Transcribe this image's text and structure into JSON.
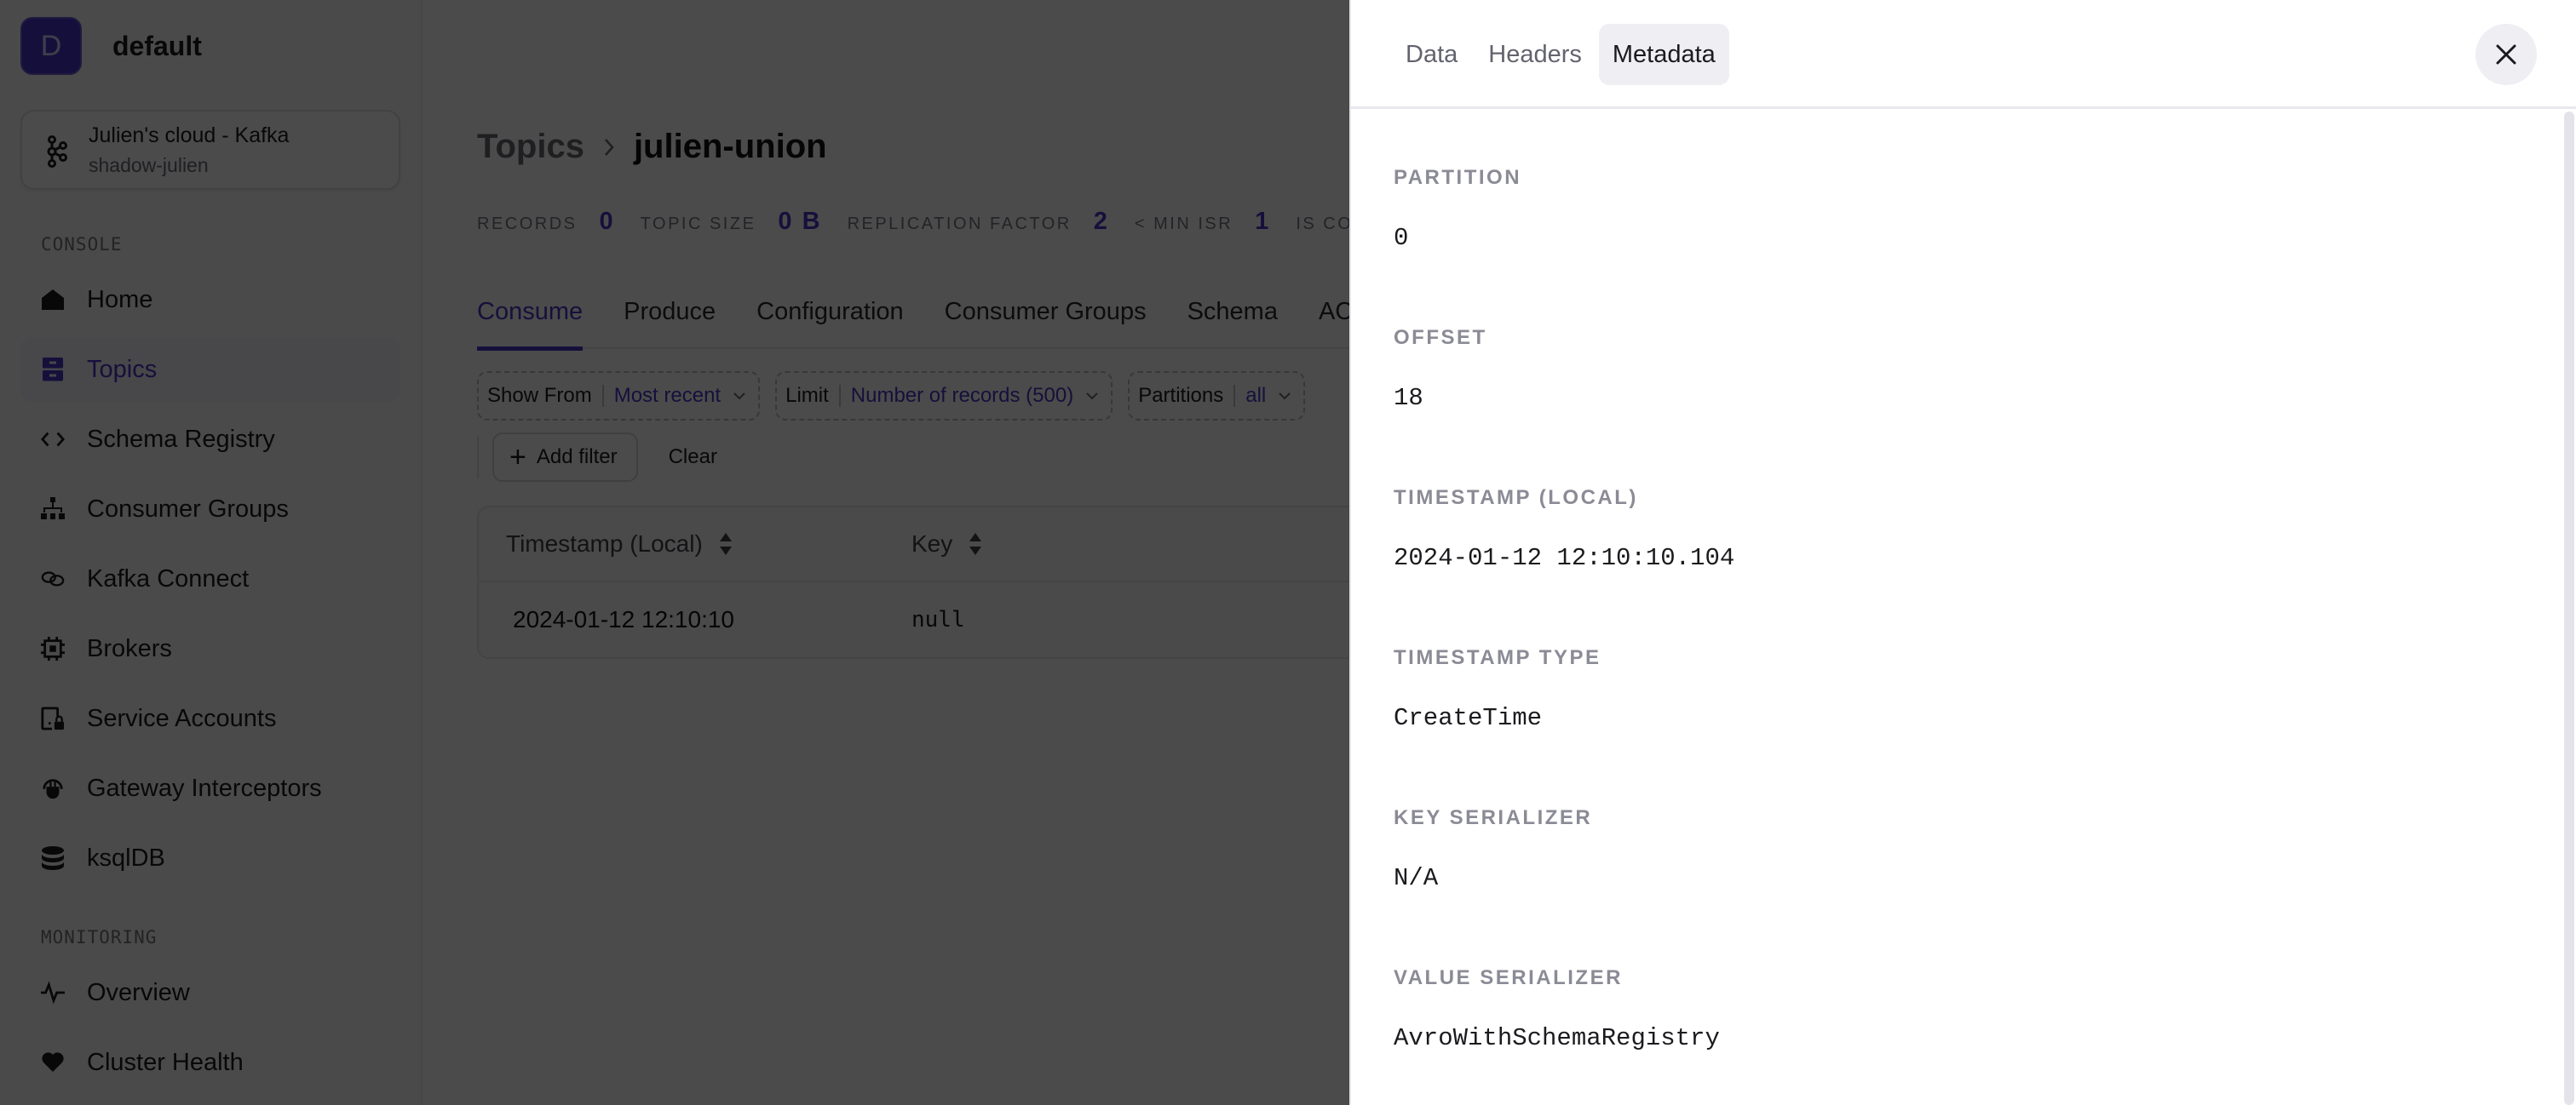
{
  "sidebar": {
    "org": {
      "initial": "D",
      "name": "default"
    },
    "cluster": {
      "name": "Julien's cloud - Kafka",
      "subtitle": "shadow-julien",
      "icon": "kafka-icon"
    },
    "sections": [
      {
        "label": "CONSOLE",
        "items": [
          {
            "label": "Home",
            "icon": "home-icon",
            "active": false
          },
          {
            "label": "Topics",
            "icon": "topics-icon",
            "active": true
          },
          {
            "label": "Schema Registry",
            "icon": "code-icon",
            "active": false
          },
          {
            "label": "Consumer Groups",
            "icon": "hierarchy-icon",
            "active": false
          },
          {
            "label": "Kafka Connect",
            "icon": "link-icon",
            "active": false
          },
          {
            "label": "Brokers",
            "icon": "chip-icon",
            "active": false
          },
          {
            "label": "Service Accounts",
            "icon": "device-lock-icon",
            "active": false
          },
          {
            "label": "Gateway Interceptors",
            "icon": "plug-icon",
            "active": false
          },
          {
            "label": "ksqlDB",
            "icon": "database-icon",
            "active": false
          }
        ]
      },
      {
        "label": "MONITORING",
        "items": [
          {
            "label": "Overview",
            "icon": "pulse-icon",
            "active": false
          },
          {
            "label": "Cluster Health",
            "icon": "heart-icon",
            "active": false
          }
        ]
      }
    ]
  },
  "main": {
    "breadcrumb": {
      "parent": "Topics",
      "current": "julien-union"
    },
    "stats": [
      {
        "label": "RECORDS",
        "value": "0"
      },
      {
        "label": "TOPIC SIZE",
        "value": "0 B"
      },
      {
        "label": "REPLICATION FACTOR",
        "value": "2"
      },
      {
        "label": "< MIN ISR",
        "value": "1"
      },
      {
        "label": "IS COM",
        "value": ""
      }
    ],
    "tabs": [
      {
        "label": "Consume",
        "active": true
      },
      {
        "label": "Produce",
        "active": false
      },
      {
        "label": "Configuration",
        "active": false
      },
      {
        "label": "Consumer Groups",
        "active": false
      },
      {
        "label": "Schema",
        "active": false
      },
      {
        "label": "ACL",
        "active": false
      }
    ],
    "filters": [
      {
        "name": "Show From",
        "value": "Most recent"
      },
      {
        "name": "Limit",
        "value": "Number of records (500)"
      },
      {
        "name": "Partitions",
        "value": "all"
      }
    ],
    "add_filter_label": "Add filter",
    "clear_label": "Clear",
    "table": {
      "columns": [
        "Timestamp (Local)",
        "Key"
      ],
      "rows": [
        {
          "timestamp": "2024-01-12 12:10:10",
          "key": "null"
        }
      ]
    }
  },
  "drawer": {
    "tabs": [
      {
        "label": "Data",
        "active": false
      },
      {
        "label": "Headers",
        "active": false
      },
      {
        "label": "Metadata",
        "active": true
      }
    ],
    "close_icon": "close-icon",
    "metadata": [
      {
        "label": "PARTITION",
        "value": "0"
      },
      {
        "label": "OFFSET",
        "value": "18"
      },
      {
        "label": "TIMESTAMP (LOCAL)",
        "value": "2024-01-12 12:10:10.104"
      },
      {
        "label": "TIMESTAMP TYPE",
        "value": "CreateTime"
      },
      {
        "label": "KEY SERIALIZER",
        "value": "N/A"
      },
      {
        "label": "VALUE SERIALIZER",
        "value": "AvroWithSchemaRegistry"
      }
    ]
  },
  "colors": {
    "accent": "#4a36c8",
    "overlay": "rgba(0,0,0,0.7)",
    "drawer_tab_active_bg": "#efeef3",
    "meta_label": "#8b8b96"
  }
}
